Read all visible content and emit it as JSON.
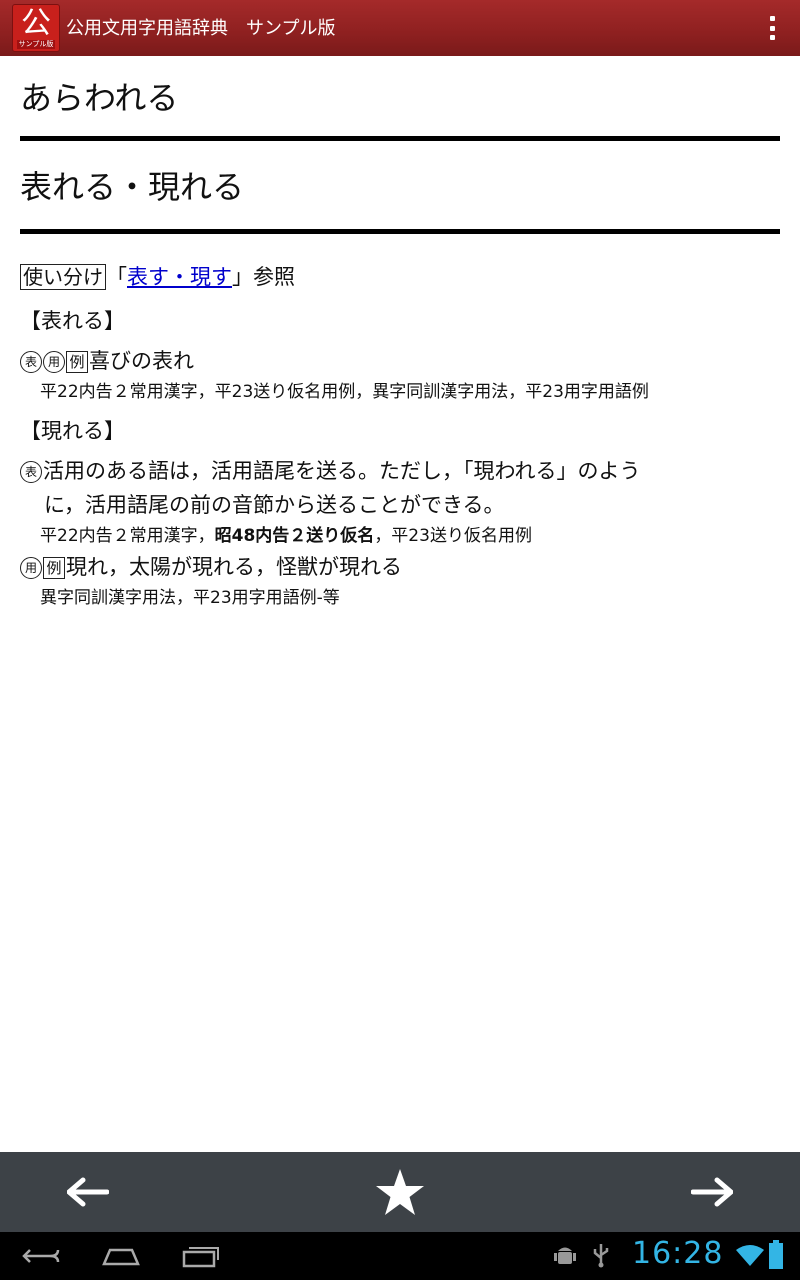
{
  "app": {
    "icon_char": "公",
    "icon_tag": "サンプル版",
    "title": "公用文用字用語辞典　サンプル版"
  },
  "entry": {
    "reading": "あらわれる",
    "headword": "表れる・現れる",
    "usage_box": "使い分け",
    "ref_open": "「",
    "ref_link": "表す・現す",
    "ref_close": "」参照",
    "sec1_title": "【表れる】",
    "sec1_marks": [
      "表",
      "用",
      "例"
    ],
    "sec1_example": "喜びの表れ",
    "sec1_sources": "平22内告２常用漢字，平23送り仮名用例，異字同訓漢字用法，平23用字用語例",
    "sec2_title": "【現れる】",
    "sec2_mark": "表",
    "sec2_text1": "活用のある語は，活用語尾を送る。ただし，「現われる」のよう",
    "sec2_text2": "に，活用語尾の前の音節から送ることができる。",
    "sec2_src_a": "平22内告２常用漢字，",
    "sec2_src_bold": "昭48内告２送り仮名",
    "sec2_src_b": "，平23送り仮名用例",
    "sec2_marks2": [
      "用",
      "例"
    ],
    "sec2_example": "現れ，太陽が現れる，怪獣が現れる",
    "sec2_sources2": "異字同訓漢字用法，平23用字用語例-等"
  },
  "status": {
    "time": "16:28"
  },
  "colors": {
    "actionbar": "#a52a2a",
    "link": "#0000cc",
    "bottombar": "#3d4247",
    "clock": "#33b5e5"
  }
}
